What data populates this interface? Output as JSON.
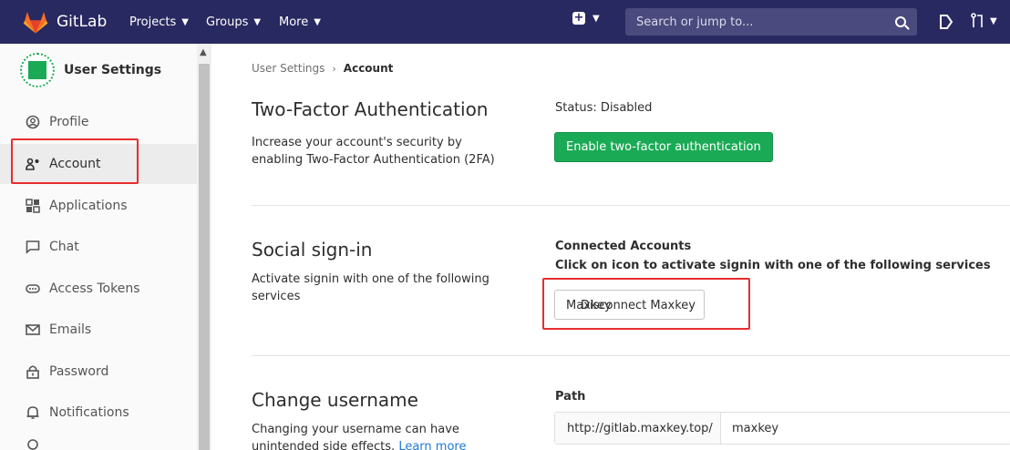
{
  "navbar": {
    "brand": "GitLab",
    "projects": "Projects",
    "groups": "Groups",
    "more": "More",
    "search_placeholder": "Search or jump to..."
  },
  "sidebar": {
    "title": "User Settings",
    "items": [
      {
        "label": "Profile",
        "icon": "profile-icon"
      },
      {
        "label": "Account",
        "icon": "account-icon"
      },
      {
        "label": "Applications",
        "icon": "applications-icon"
      },
      {
        "label": "Chat",
        "icon": "chat-icon"
      },
      {
        "label": "Access Tokens",
        "icon": "access-tokens-icon"
      },
      {
        "label": "Emails",
        "icon": "emails-icon"
      },
      {
        "label": "Password",
        "icon": "password-icon"
      },
      {
        "label": "Notifications",
        "icon": "notifications-icon"
      }
    ]
  },
  "breadcrumb": {
    "parent": "User Settings",
    "separator": "›",
    "current": "Account"
  },
  "two_factor": {
    "title": "Two-Factor Authentication",
    "description": "Increase your account's security by enabling Two-Factor Authentication (2FA)",
    "status": "Status: Disabled",
    "button": "Enable two-factor authentication"
  },
  "social": {
    "title": "Social sign-in",
    "description": "Activate signin with one of the following services",
    "connected_label": "Connected Accounts",
    "instructions": "Click on icon to activate signin with one of the following services",
    "button_text_a": "Maxkey",
    "button_text_b": "Disconnect Maxkey"
  },
  "username": {
    "title": "Change username",
    "description": "Changing your username can have unintended side effects.",
    "learn_more": "Learn more",
    "path_label": "Path",
    "path_prefix": "http://gitlab.maxkey.top/",
    "path_value": "maxkey"
  },
  "colors": {
    "navbar": "#292961",
    "primary_green": "#1aaa55",
    "highlight_red": "#e62e2e",
    "link_blue": "#1f78d1"
  }
}
